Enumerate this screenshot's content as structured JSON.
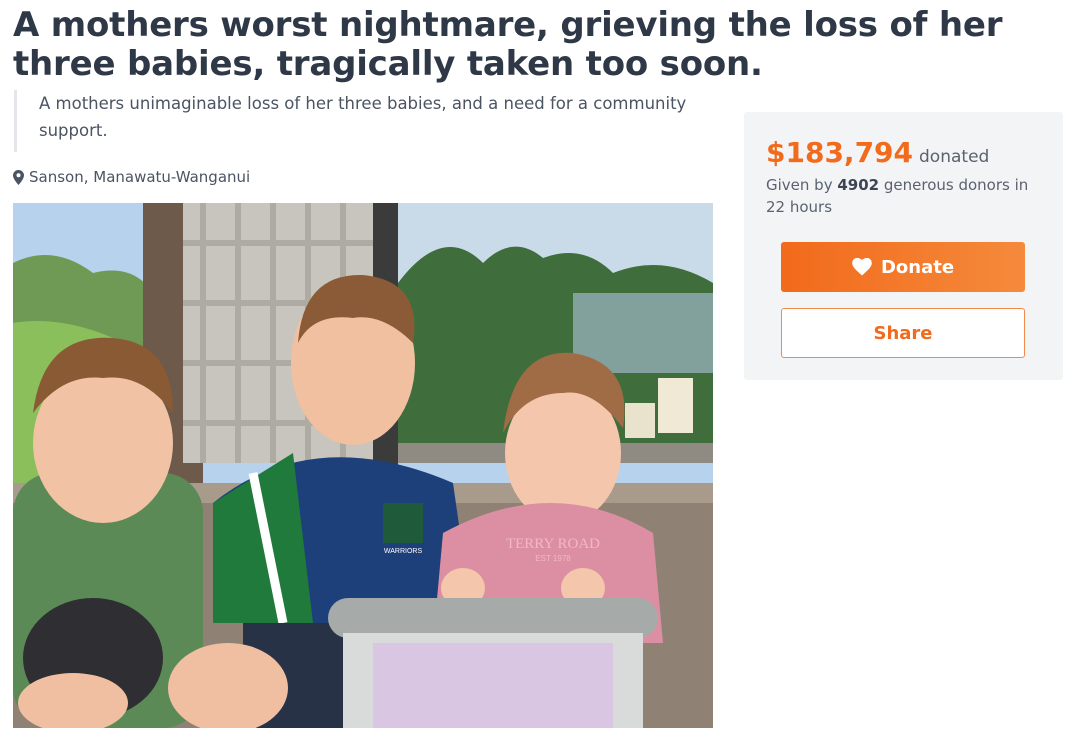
{
  "campaign": {
    "title": "A mothers worst nightmare, grieving the loss of her three babies, tragically taken too soon.",
    "summary": "A mothers unimaginable loss of her three babies, and a need for a community support.",
    "location": "Sanson, Manawatu-Wanganui",
    "location_icon": "map-marker-icon"
  },
  "photo": {
    "shirt_badge_text": "WARRIORS",
    "sweater_text": "TERRY ROAD",
    "sweater_subtext": "EST 1978"
  },
  "sidebar": {
    "amount": "$183,794",
    "amount_label": "donated",
    "given_by_prefix": "Given by",
    "donor_count": "4902",
    "given_by_suffix": "generous donors in 22 hours",
    "donate_label": "Donate",
    "donate_icon": "heart-icon",
    "share_label": "Share"
  },
  "colors": {
    "accent": "#f26a1b",
    "title": "#2f3847",
    "sidebar_bg": "#f3f4f6"
  }
}
